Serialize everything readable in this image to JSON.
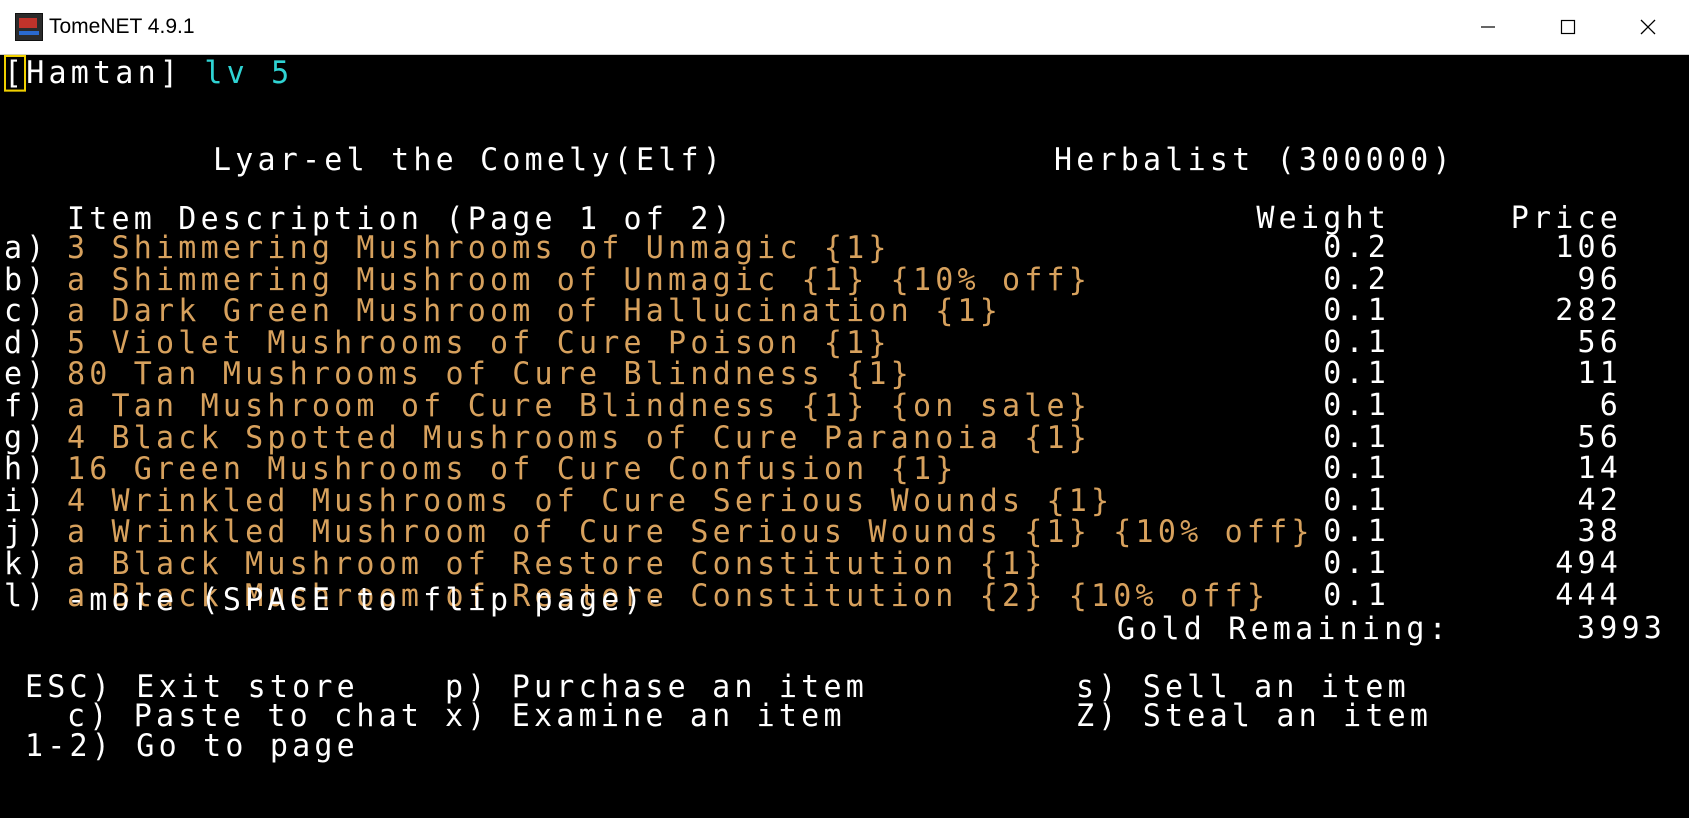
{
  "window": {
    "title": "TomeNET 4.9.1"
  },
  "player": {
    "bracket_open": "[",
    "name_rest": "Hamtan]",
    "level": "lv 5"
  },
  "store": {
    "owner": "Lyar-el the Comely(Elf)",
    "store_name": "Herbalist (300000)"
  },
  "table": {
    "header_desc": "Item Description (Page 1 of 2)",
    "header_weight": "Weight",
    "header_price": "Price",
    "rows": [
      {
        "key": "a)",
        "desc": "3 Shimmering Mushrooms of Unmagic {1}",
        "weight": "0.2",
        "price": "106"
      },
      {
        "key": "b)",
        "desc": "a Shimmering Mushroom of Unmagic {1} {10% off}",
        "weight": "0.2",
        "price": "96"
      },
      {
        "key": "c)",
        "desc": "a Dark Green Mushroom of Hallucination {1}",
        "weight": "0.1",
        "price": "282"
      },
      {
        "key": "d)",
        "desc": "5 Violet Mushrooms of Cure Poison {1}",
        "weight": "0.1",
        "price": "56"
      },
      {
        "key": "e)",
        "desc": "80 Tan Mushrooms of Cure Blindness {1}",
        "weight": "0.1",
        "price": "11"
      },
      {
        "key": "f)",
        "desc": "a Tan Mushroom of Cure Blindness {1} {on sale}",
        "weight": "0.1",
        "price": "6"
      },
      {
        "key": "g)",
        "desc": "4 Black Spotted Mushrooms of Cure Paranoia {1}",
        "weight": "0.1",
        "price": "56"
      },
      {
        "key": "h)",
        "desc": "16 Green Mushrooms of Cure Confusion {1}",
        "weight": "0.1",
        "price": "14"
      },
      {
        "key": "i)",
        "desc": "4 Wrinkled Mushrooms of Cure Serious Wounds {1}",
        "weight": "0.1",
        "price": "42"
      },
      {
        "key": "j)",
        "desc": "a Wrinkled Mushroom of Cure Serious Wounds {1} {10% off}",
        "weight": "0.1",
        "price": "38"
      },
      {
        "key": "k)",
        "desc": "a Black Mushroom of Restore Constitution {1}",
        "weight": "0.1",
        "price": "494"
      },
      {
        "key": "l)",
        "desc": "a Black Mushroom of Restore Constitution {2} {10% off}",
        "weight": "0.1",
        "price": "444"
      }
    ],
    "more_text": "-more (SPACE to flip page)-"
  },
  "gold": {
    "label": "Gold Remaining:",
    "value": "3993"
  },
  "commands": {
    "esc": "ESC) Exit store",
    "purchase": "p) Purchase an item",
    "sell": "s) Sell an item",
    "paste": "c) Paste to chat",
    "examine": "x) Examine an item",
    "steal": "Z) Steal an item",
    "page": "1-2) Go to page"
  },
  "colors": {
    "background": "#000000",
    "text_white": "#ffffff",
    "item_orange": "#d7a15d",
    "level_cyan": "#2fd3d3",
    "cursor_yellow": "#f0d000"
  }
}
